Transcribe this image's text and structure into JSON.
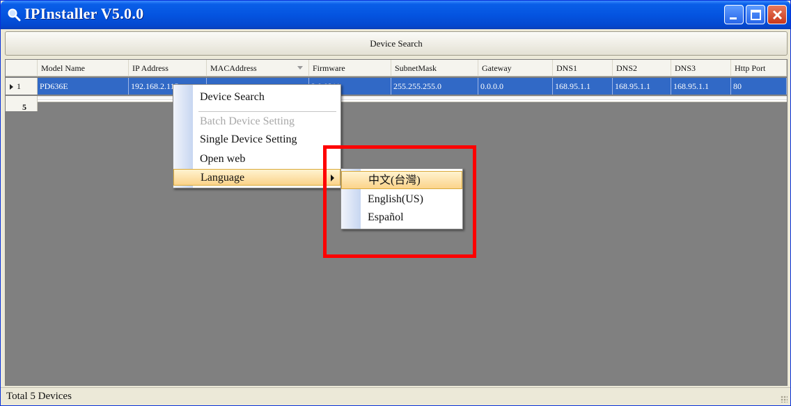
{
  "window": {
    "title": "IPInstaller V5.0.0",
    "icon": "magnifier-icon"
  },
  "toolbar": {
    "device_search_label": "Device Search"
  },
  "table": {
    "columns": [
      "Model Name",
      "IP Address",
      "MACAddress",
      "Firmware",
      "SubnetMask",
      "Gateway",
      "DNS1",
      "DNS2",
      "DNS3",
      "Http Port"
    ],
    "selected_row": {
      "index": "1",
      "cells": [
        "PD636E",
        "192.168.2.115",
        "",
        "2.0.0211",
        "255.255.255.0",
        "0.0.0.0",
        "168.95.1.1",
        "168.95.1.1",
        "168.95.1.1",
        "80"
      ]
    },
    "next_row_index": "5"
  },
  "context_menu": {
    "items": [
      {
        "label": "Device Search",
        "enabled": true
      },
      {
        "label": "Batch Device Setting",
        "enabled": false
      },
      {
        "label": "Single Device Setting",
        "enabled": true
      },
      {
        "label": "Open web",
        "enabled": true
      },
      {
        "label": "Language",
        "enabled": true,
        "has_submenu": true
      }
    ]
  },
  "language_submenu": {
    "items": [
      "中文(台灣)",
      "English(US)",
      "Español"
    ]
  },
  "status": {
    "text": "Total 5 Devices"
  },
  "colors": {
    "titlebar": "#0454e0",
    "selection": "#3169c6",
    "menu_highlight": "#fbd38a",
    "annotation": "#ff0000"
  }
}
